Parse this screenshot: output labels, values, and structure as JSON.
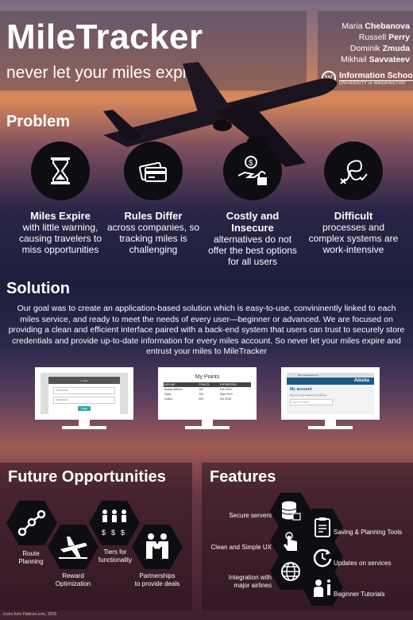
{
  "header": {
    "title": "MileTracker",
    "tagline": "never let your miles expire",
    "authors": [
      {
        "first": "Maria ",
        "last": "Chebanova"
      },
      {
        "first": "Russell ",
        "last": "Perry"
      },
      {
        "first": "Dominik ",
        "last": "Zmuda"
      },
      {
        "first": "Mikhail ",
        "last": "Savvateev"
      }
    ],
    "school_name": "Information School",
    "school_univ": "UNIVERSITY of WASHINGTON",
    "school_logo_letter": "W"
  },
  "problem": {
    "heading": "Problem",
    "items": [
      {
        "title": "Miles Expire",
        "desc": "with little warning, causing travelers to miss opportunities",
        "icon": "hourglass-icon"
      },
      {
        "title": "Rules Differ",
        "desc": "across companies, so tracking miles is challenging",
        "icon": "credit-cards-icon"
      },
      {
        "title": "Costly and Insecure",
        "desc": "alternatives do not offer the best options for all users",
        "icon": "money-lock-icon"
      },
      {
        "title": "Difficult",
        "desc": "processes and complex systems are work-intensive",
        "icon": "tangled-path-icon"
      }
    ]
  },
  "solution": {
    "heading": "Solution",
    "text": "Our goal was to create an application-based solution which is easy-to-use, convininently linked to each miles service, and ready to meet the needs of every user—beginner or advanced. We are focused on providing a clean and efficient interface paired with a back-end system that users can trust to securely store credentials and provide up-to-date information for every miles account. So never let your miles expire and entrust your miles to MileTracker",
    "screens": {
      "login": {
        "header": "Login",
        "field1": "username",
        "field2": "password",
        "button": "Login"
      },
      "points": {
        "title": "My Points",
        "columns": [
          "AIRLINE",
          "POINTS",
          "EXPIRATION"
        ],
        "rows": [
          [
            "Alaska Airlines",
            "100",
            "Feb 2018"
          ],
          [
            "Delta",
            "200",
            "Sept 2019"
          ],
          [
            "United",
            "500",
            "Oct 2018"
          ]
        ]
      },
      "alaska": {
        "url": "http://alaskaair.com",
        "brand": "Alaska",
        "account": "My account",
        "signin": "Sign in to your account to continue.",
        "field": "User ID or MP#"
      }
    }
  },
  "future": {
    "heading": "Future Opportunities",
    "items": [
      {
        "label": "Route\nPlanning",
        "icon": "route-nodes-icon"
      },
      {
        "label": "Reward\nOptimization",
        "icon": "airplane-icon"
      },
      {
        "label": "Tiers for\nfunctionality",
        "icon": "people-money-icon"
      },
      {
        "label": "Partnerships\nto provide deals",
        "icon": "handshake-icon"
      }
    ]
  },
  "features": {
    "heading": "Features",
    "items": [
      {
        "label": "Secure servers",
        "icon": "database-lock-icon"
      },
      {
        "label": "Saving & Planning Tools",
        "icon": "clipboard-icon"
      },
      {
        "label": "Clean and Simple UX",
        "icon": "touch-hand-icon"
      },
      {
        "label": "Updates on services",
        "icon": "refresh-clock-icon"
      },
      {
        "label": "Integration with\nmajor airlines",
        "icon": "globe-icon"
      },
      {
        "label": "Beginner Tutorials",
        "icon": "info-person-icon"
      }
    ]
  },
  "footer": {
    "credit": "Icons from Flaticon.com, 2018"
  }
}
